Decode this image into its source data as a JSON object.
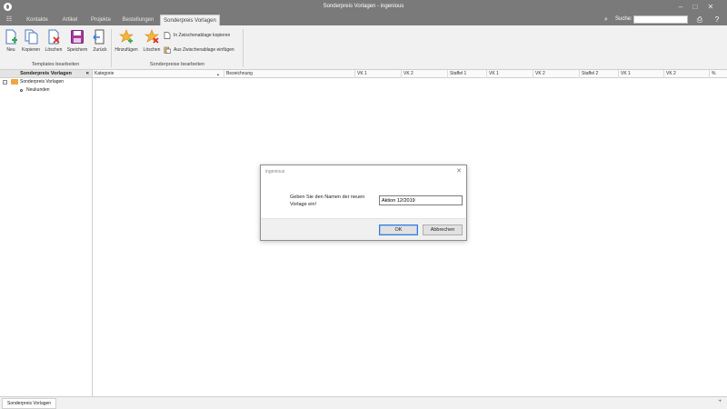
{
  "window": {
    "title": "Sonderpreis Vorlagen - ingenious"
  },
  "tabs": [
    {
      "label": "Kontakte"
    },
    {
      "label": "Artikel"
    },
    {
      "label": "Projekte"
    },
    {
      "label": "Bestellungen"
    },
    {
      "label": "Sonderpreis Vorlagen",
      "active": true
    }
  ],
  "search": {
    "label": "Suche:",
    "value": ""
  },
  "ribbon": {
    "templates_group": {
      "label": "Templates bearbeiten",
      "buttons": [
        "Neu",
        "Kopieren",
        "Löschen",
        "Speichern",
        "Zurück"
      ]
    },
    "specialprices_group": {
      "label": "Sonderpreise bearbeiten",
      "buttons": [
        "Hinzufügen",
        "Löschen"
      ],
      "small_buttons": [
        "In Zwischenablage kopieren",
        "Aus Zwischenablage einfügen"
      ]
    }
  },
  "left_panel": {
    "header": "Sonderpreis Vorlagen",
    "tree": {
      "root": "Sonderpreis Vorlagen",
      "children": [
        "Neukunden"
      ]
    }
  },
  "grid": {
    "columns": [
      "Kategorie",
      "Bezeichnung",
      "VK 1",
      "VK 2",
      "Staffel 1",
      "VK 1",
      "VK 2",
      "Staffel 2",
      "VK 1",
      "VK 2",
      "%"
    ]
  },
  "status": {
    "tab_label": "Sonderpreis Vorlagen"
  },
  "dialog": {
    "title": "ingenious",
    "prompt": "Geben Sie den Namen der neuen Vorlage ein!",
    "input_value": "Aktion 12/2019",
    "ok_label": "OK",
    "cancel_label": "Abbrechen"
  },
  "colors": {
    "titlebar": "#7a7a7a",
    "ribbon": "#f1f1f1",
    "accent": "#3a7bd5",
    "folder": "#f0a640"
  }
}
